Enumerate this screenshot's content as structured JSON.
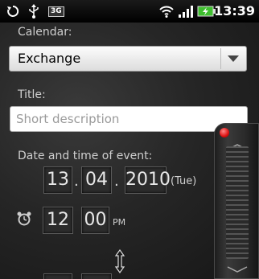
{
  "status_bar": {
    "time": "13:39",
    "network_badge": "3G",
    "icons": [
      "sync-icon",
      "usb-icon",
      "3g-icon",
      "wifi-icon",
      "signal-icon",
      "battery-charging-icon"
    ]
  },
  "form": {
    "calendar_label": "Calendar:",
    "calendar_value": "Exchange",
    "title_label": "Title:",
    "title_placeholder": "Short description",
    "datetime_label": "Date and time of event:",
    "date": {
      "day": "13",
      "month": "04",
      "year": "2010",
      "weekday": "(Tue)",
      "separator": "."
    },
    "time": {
      "hour": "12",
      "minute": "00",
      "ampm": "PM"
    }
  },
  "colors": {
    "background": "#262626",
    "label_text": "#cfcfcf",
    "field_text": "#e8e8e8",
    "scroll_dot": "#dd1111"
  }
}
